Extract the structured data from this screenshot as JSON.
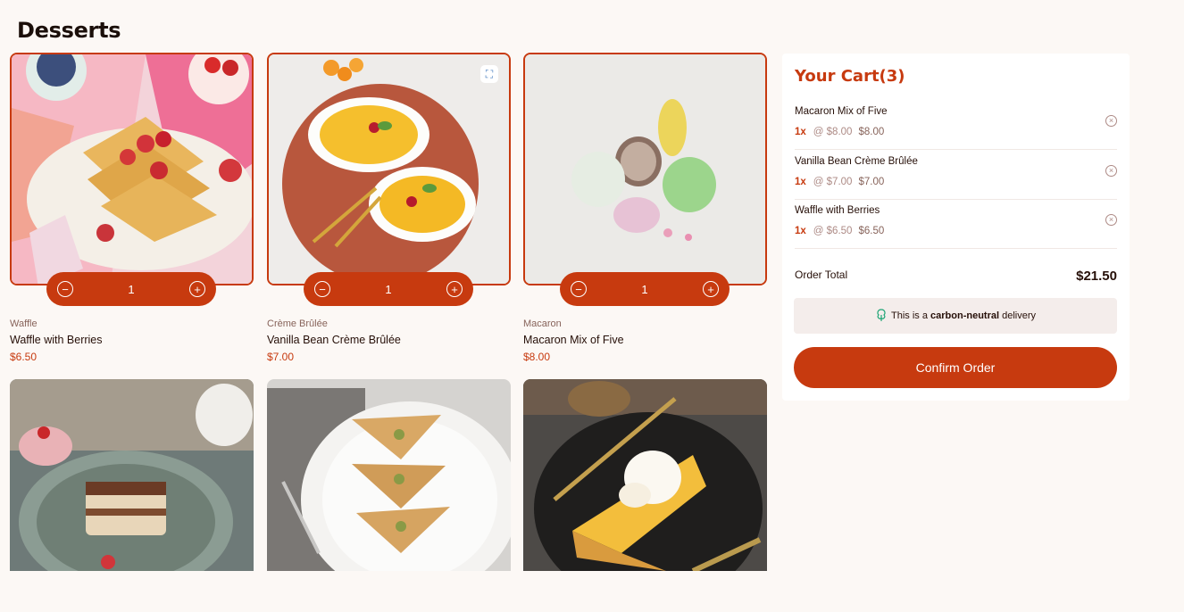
{
  "page": {
    "title": "Desserts"
  },
  "products": [
    {
      "category": "Waffle",
      "name": "Waffle with Berries",
      "price": "$6.50",
      "quantity": "1"
    },
    {
      "category": "Crème Brûlée",
      "name": "Vanilla Bean Crème Brûlée",
      "price": "$7.00",
      "quantity": "1"
    },
    {
      "category": "Macaron",
      "name": "Macaron Mix of Five",
      "price": "$8.00",
      "quantity": "1"
    }
  ],
  "cart": {
    "title": "Your Cart(3)",
    "items": [
      {
        "name": "Macaron Mix of Five",
        "qty": "1x",
        "unit": "@ $8.00",
        "total": "$8.00"
      },
      {
        "name": "Vanilla Bean Crème Brûlée",
        "qty": "1x",
        "unit": "@ $7.00",
        "total": "$7.00"
      },
      {
        "name": "Waffle with Berries",
        "qty": "1x",
        "unit": "@ $6.50",
        "total": "$6.50"
      }
    ],
    "order_total_label": "Order Total",
    "order_total": "$21.50",
    "carbon": {
      "prefix": "This is a ",
      "bold": "carbon-neutral",
      "suffix": " delivery"
    },
    "confirm_label": "Confirm Order"
  },
  "colors": {
    "accent": "#c73a0f",
    "background": "#fcf8f5",
    "text": "#260f08",
    "muted": "#87635a"
  },
  "icons": [
    "minus-circle-icon",
    "plus-circle-icon",
    "remove-circle-icon",
    "tree-icon",
    "scan-icon"
  ]
}
